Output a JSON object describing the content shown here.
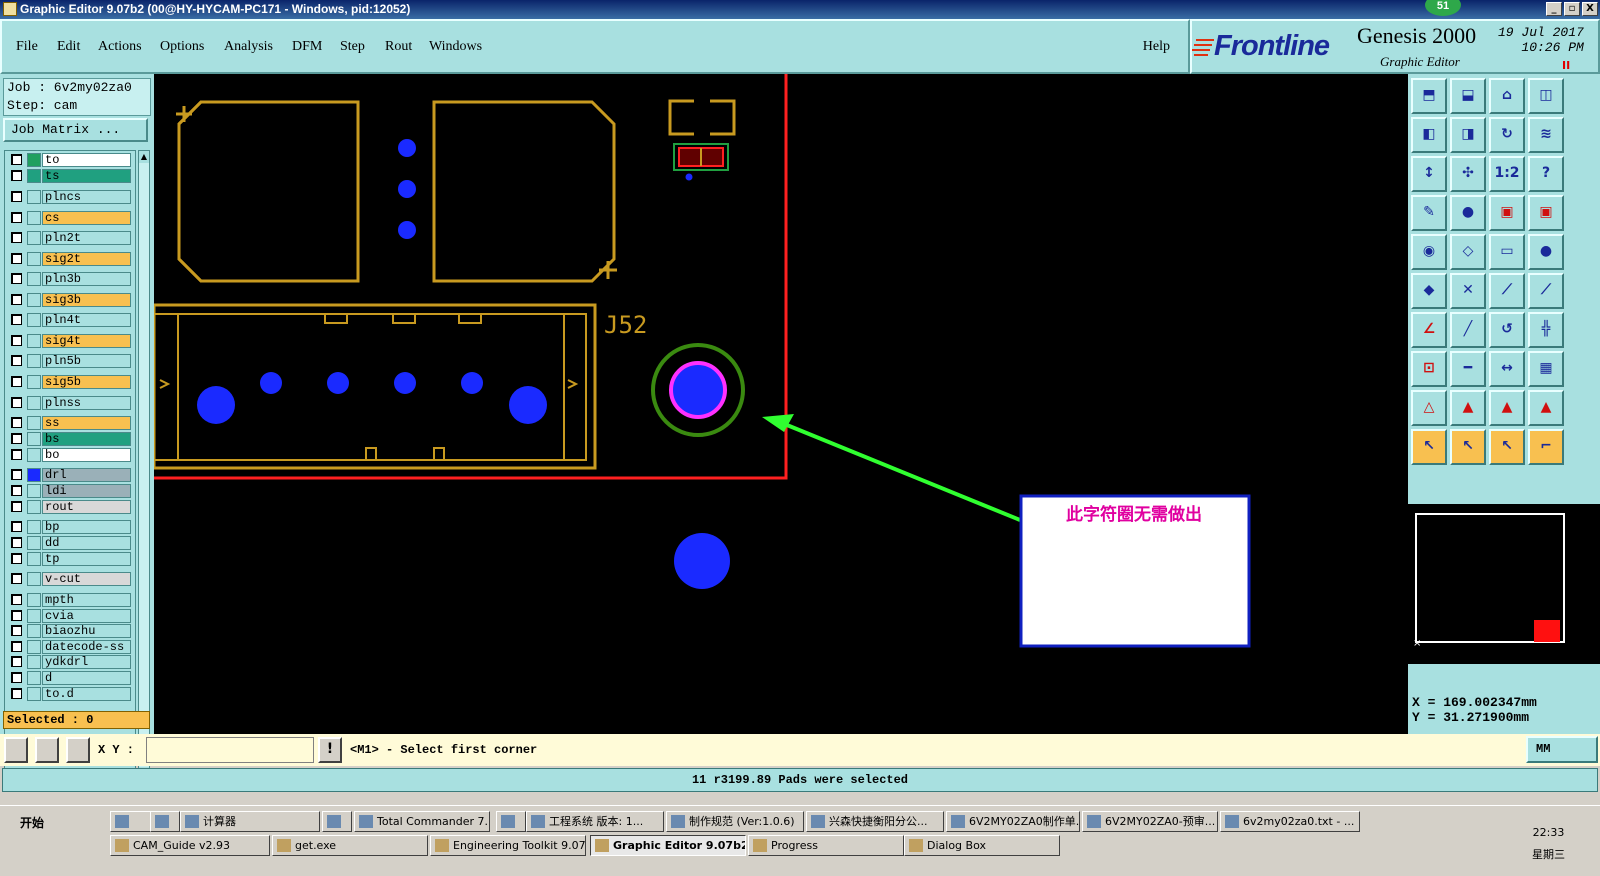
{
  "window": {
    "title": "Graphic Editor 9.07b2 (00@HY-HYCAM-PC171 - Windows, pid:12052)",
    "badge": "51",
    "buttons": {
      "min": "_",
      "max": "▫",
      "close": "X"
    }
  },
  "menu": {
    "items": [
      "File",
      "Edit",
      "Actions",
      "Options",
      "Analysis",
      "DFM",
      "Step",
      "Rout",
      "Windows"
    ],
    "help": "Help"
  },
  "brand": {
    "logo": "Frontline",
    "product": "Genesis 2000",
    "subtitle": "Graphic Editor",
    "date": "19 Jul 2017",
    "time": "10:26 PM",
    "pause": "II"
  },
  "job": {
    "job_line": "Job : 6v2my02za0",
    "step_line": "Step: cam",
    "matrix_button": "Job Matrix ..."
  },
  "layers": [
    {
      "name": "to",
      "color": "#ffffff",
      "swatch": "#20a060",
      "arrow": true
    },
    {
      "name": "ts",
      "color": "#20a080",
      "swatch": "#20a080",
      "arrow": true
    },
    {
      "name": "plncs",
      "color": "#a8e0e0",
      "swatch": "#a8e0e0",
      "arrow": false
    },
    {
      "name": "cs",
      "color": "#f8c050",
      "swatch": "#a8e0e0",
      "arrow": false
    },
    {
      "name": "pln2t",
      "color": "#a8e0e0",
      "swatch": "#a8e0e0",
      "arrow": false
    },
    {
      "name": "sig2t",
      "color": "#f8c050",
      "swatch": "#a8e0e0",
      "arrow": true
    },
    {
      "name": "pln3b",
      "color": "#a8e0e0",
      "swatch": "#a8e0e0",
      "arrow": false
    },
    {
      "name": "sig3b",
      "color": "#f8c050",
      "swatch": "#a8e0e0",
      "arrow": true
    },
    {
      "name": "pln4t",
      "color": "#a8e0e0",
      "swatch": "#a8e0e0",
      "arrow": false
    },
    {
      "name": "sig4t",
      "color": "#f8c050",
      "swatch": "#a8e0e0",
      "arrow": true
    },
    {
      "name": "pln5b",
      "color": "#a8e0e0",
      "swatch": "#a8e0e0",
      "arrow": false
    },
    {
      "name": "sig5b",
      "color": "#f8c050",
      "swatch": "#a8e0e0",
      "arrow": true
    },
    {
      "name": "plnss",
      "color": "#a8e0e0",
      "swatch": "#a8e0e0",
      "arrow": false
    },
    {
      "name": "ss",
      "color": "#f8c050",
      "swatch": "#a8e0e0",
      "arrow": true
    },
    {
      "name": "bs",
      "color": "#20a080",
      "swatch": "#a8e0e0",
      "arrow": true
    },
    {
      "name": "bo",
      "color": "#ffffff",
      "swatch": "#a8e0e0",
      "arrow": true
    },
    {
      "name": "drl",
      "color": "#9ab0b8",
      "swatch": "#1a2aff",
      "arrow": false
    },
    {
      "name": "ldi",
      "color": "#9ab0b8",
      "swatch": "#a8e0e0",
      "arrow": false
    },
    {
      "name": "rout",
      "color": "#d8d8d8",
      "swatch": "#a8e0e0",
      "arrow": false
    },
    {
      "name": "bp",
      "color": "#a8e0e0",
      "swatch": "#a8e0e0",
      "arrow": false
    },
    {
      "name": "dd",
      "color": "#a8e0e0",
      "swatch": "#a8e0e0",
      "arrow": false
    },
    {
      "name": "tp",
      "color": "#a8e0e0",
      "swatch": "#a8e0e0",
      "arrow": false
    },
    {
      "name": "v-cut",
      "color": "#d8d8d8",
      "swatch": "#a8e0e0",
      "arrow": false
    },
    {
      "name": "mpth",
      "color": "#a8e0e0",
      "swatch": "#a8e0e0",
      "arrow": false
    },
    {
      "name": "cvia",
      "color": "#a8e0e0",
      "swatch": "#a8e0e0",
      "arrow": false
    },
    {
      "name": "biaozhu",
      "color": "#a8e0e0",
      "swatch": "#a8e0e0",
      "arrow": false
    },
    {
      "name": "datecode-ss",
      "color": "#a8e0e0",
      "swatch": "#a8e0e0",
      "arrow": false
    },
    {
      "name": "ydkdrl",
      "color": "#a8e0e0",
      "swatch": "#a8e0e0",
      "arrow": false
    },
    {
      "name": "d",
      "color": "#a8e0e0",
      "swatch": "#a8e0e0",
      "arrow": false
    },
    {
      "name": "to.d",
      "color": "#a8e0e0",
      "swatch": "#a8e0e0",
      "arrow": true
    }
  ],
  "selected_count": "Selected : 0",
  "canvas": {
    "component_label": "J52",
    "annotation": "此字符圈无需做出"
  },
  "coords": {
    "x": "X = 169.002347mm",
    "y": "Y = 31.271900mm"
  },
  "command": {
    "xy_label": "X Y :",
    "xy_value": "",
    "prompt": "<M1> - Select first corner",
    "unit": "MM"
  },
  "status": "11 r3199.89 Pads were selected",
  "taskbar": {
    "start": "开始",
    "row1": [
      "",
      "",
      "计算器",
      "",
      "Total Commander 7....",
      "",
      "工程系统 版本: 1...",
      "制作规范 (Ver:1.0.6)",
      "兴森快捷衡阳分公...",
      "6V2MY02ZA0制作单...",
      "6V2MY02ZA0-预审...",
      "6v2my02za0.txt - ..."
    ],
    "row2": [
      "CAM_Guide v2.93",
      "get.exe",
      "Engineering Toolkit 9.07...",
      "Graphic Editor 9.07b2 ...",
      "Progress",
      "Dialog Box"
    ],
    "time": "22:33",
    "weekday": "星期三"
  }
}
